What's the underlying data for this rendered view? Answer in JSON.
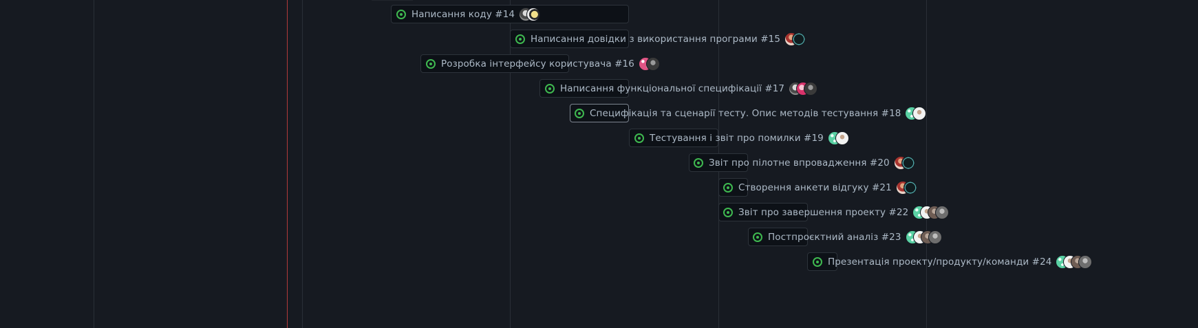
{
  "theme": {
    "background": "#161a21",
    "bar_background": "#0d1117",
    "bar_border": "#2d333b",
    "status_open_color": "#3fb950",
    "today_line_color": "#b33a3a",
    "text_color": "#adbac7"
  },
  "items": [
    {
      "title": "Написання коду #14",
      "status_icon": "issue-opened-icon",
      "avatars": [
        "av-gray-face",
        "av-yellow"
      ]
    },
    {
      "title": "Написання довідки з використання програми #15",
      "status_icon": "issue-opened-icon",
      "avatars": [
        "av-red-person",
        "av-dark-teal"
      ]
    },
    {
      "title": "Розробка інтерфейсу користувача #16",
      "status_icon": "issue-opened-icon",
      "avatars": [
        "av-pink-pattern",
        "av-dark-gray"
      ]
    },
    {
      "title": "Написання функціональної специфікації #17",
      "status_icon": "issue-opened-icon",
      "avatars": [
        "av-gray-face",
        "av-pink-red",
        "av-dark-gray"
      ]
    },
    {
      "title": "Специфікація та сценарії тесту. Опис методів тестування #18",
      "status_icon": "issue-opened-icon",
      "selected": true,
      "avatars": [
        "av-mint-dots",
        "av-white-figure"
      ]
    },
    {
      "title": "Тестування і звіт про помилки #19",
      "status_icon": "issue-opened-icon",
      "avatars": [
        "av-mint-dots",
        "av-white-figure"
      ]
    },
    {
      "title": "Звіт про пілотне впровадження #20",
      "status_icon": "issue-opened-icon",
      "avatars": [
        "av-red-person",
        "av-dark-teal"
      ]
    },
    {
      "title": "Створення анкети відгуку #21",
      "status_icon": "issue-opened-icon",
      "avatars": [
        "av-red-person",
        "av-dark-teal"
      ]
    },
    {
      "title": "Звіт про завершення проекту #22",
      "status_icon": "issue-opened-icon",
      "avatars": [
        "av-mint-dots",
        "av-white-figure",
        "av-brown",
        "av-gray"
      ]
    },
    {
      "title": "Постпроєктний аналіз #23",
      "status_icon": "issue-opened-icon",
      "avatars": [
        "av-mint-dots",
        "av-white-figure",
        "av-brown",
        "av-gray"
      ]
    },
    {
      "title": "Презентація проекту/продукту/команди #24",
      "status_icon": "issue-opened-icon",
      "avatars": [
        "av-mint-dots",
        "av-white-figure",
        "av-brown",
        "av-gray"
      ]
    }
  ]
}
